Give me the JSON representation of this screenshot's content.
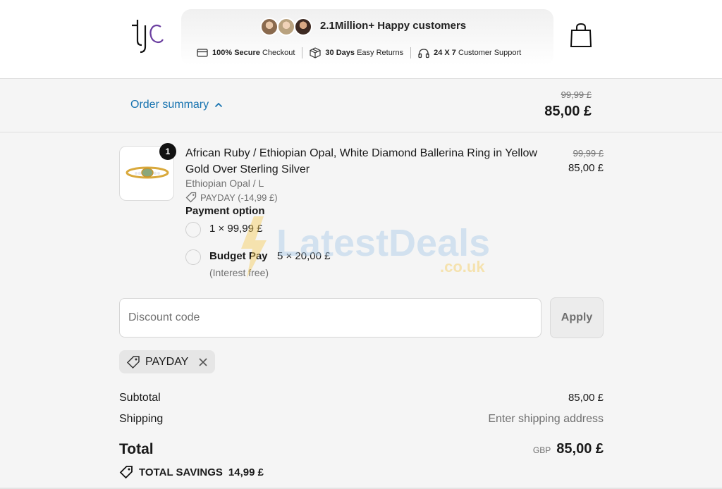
{
  "header": {
    "logo_text": "tjc",
    "customers_text": "2.1Million+ Happy customers",
    "trust": [
      {
        "bold": "100% Secure",
        "rest": " Checkout",
        "icon": "card-icon"
      },
      {
        "bold": "30 Days",
        "rest": " Easy Returns",
        "icon": "box-icon"
      },
      {
        "bold": "24 X 7",
        "rest": " Customer Support",
        "icon": "headset-icon"
      }
    ],
    "cart_icon": "shopping-bag-icon"
  },
  "summary": {
    "toggle_label": "Order summary",
    "old_price": "99,99 £",
    "total": "85,00 £"
  },
  "product": {
    "quantity": "1",
    "name": "African Ruby / Ethiopian Opal, White Diamond Ballerina Ring in Yellow Gold Over Sterling Silver",
    "variant": "Ethiopian Opal / L",
    "discount_note": "PAYDAY (-14,99 £)",
    "old_price": "99,99 £",
    "price": "85,00 £"
  },
  "payment": {
    "title": "Payment option",
    "option1": "1 × 99,99 £",
    "option2_label": "Budget Pay",
    "option2_value": "5 × 20,00 £",
    "option2_note": "(Interest free)"
  },
  "watermark": {
    "main": "LatestDeals",
    "sub": ".co.uk"
  },
  "discount": {
    "placeholder": "Discount code",
    "value": "",
    "apply_label": "Apply",
    "applied_code": "PAYDAY"
  },
  "totals": {
    "subtotal_label": "Subtotal",
    "subtotal_value": "85,00 £",
    "shipping_label": "Shipping",
    "shipping_value": "Enter shipping address",
    "total_label": "Total",
    "currency": "GBP",
    "total_value": "85,00 £",
    "savings_label": "TOTAL SAVINGS",
    "savings_value": "14,99 £"
  },
  "colors": {
    "link": "#1773b0",
    "background": "#f5f5f5",
    "text": "#1a1a1a",
    "muted": "#707070"
  }
}
